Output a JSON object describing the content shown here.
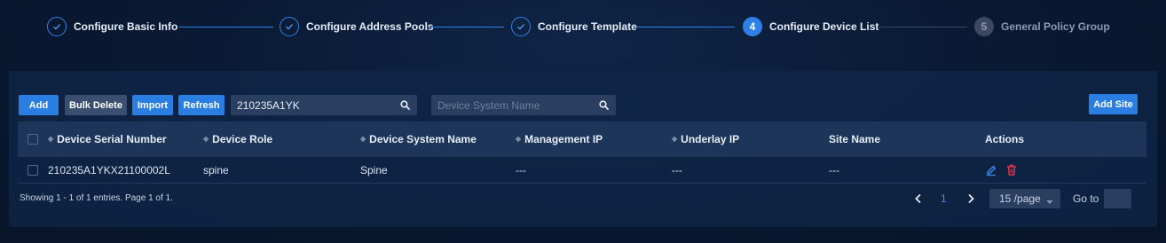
{
  "stepper": {
    "steps": [
      {
        "label": "Configure Basic Info",
        "state": "done"
      },
      {
        "label": "Configure Address Pools",
        "state": "done"
      },
      {
        "label": "Configure Template",
        "state": "done"
      },
      {
        "label": "Configure Device List",
        "state": "active",
        "number": "4"
      },
      {
        "label": "General Policy Group",
        "state": "pending",
        "number": "5"
      }
    ]
  },
  "toolbar": {
    "add_label": "Add",
    "bulk_delete_label": "Bulk Delete",
    "import_label": "Import",
    "refresh_label": "Refresh",
    "add_site_label": "Add Site"
  },
  "search_serial": {
    "value": "210235A1YK",
    "placeholder": ""
  },
  "search_name": {
    "value": "",
    "placeholder": "Device System Name"
  },
  "table": {
    "columns": [
      "Device Serial Number",
      "Device Role",
      "Device System Name",
      "Management IP",
      "Underlay IP",
      "Site Name",
      "Actions"
    ],
    "rows": [
      {
        "serial": "210235A1YKX21100002L",
        "role": "spine",
        "system_name": "Spine",
        "management_ip": "---",
        "underlay_ip": "---",
        "site_name": "---"
      }
    ]
  },
  "footer": {
    "summary": "Showing 1 - 1 of 1 entries. Page 1 of 1.",
    "current_page": "1",
    "page_size": "15 /page",
    "goto_label": "Go to",
    "goto_value": ""
  },
  "icons": {
    "edit": "edit-icon",
    "delete": "delete-icon",
    "search": "search-icon",
    "check": "check-icon"
  },
  "colors": {
    "accent": "#2a7de1",
    "delete": "#e0344b",
    "link": "#3b8cf0"
  }
}
